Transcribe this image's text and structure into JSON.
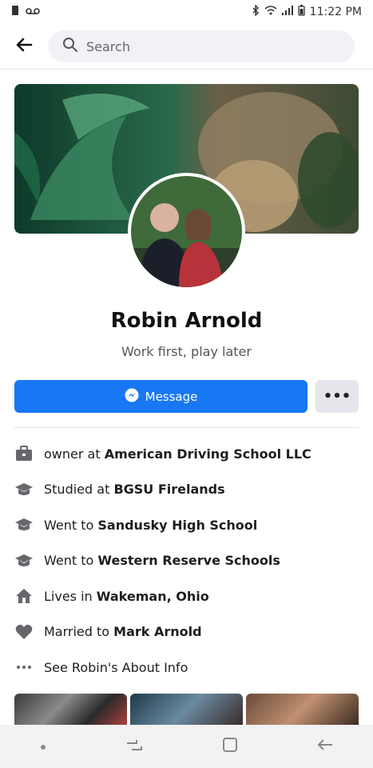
{
  "status": {
    "time": "11:22 PM"
  },
  "search": {
    "placeholder": "Search"
  },
  "profile": {
    "name": "Robin Arnold",
    "bio": "Work first, play later",
    "message_label": "Message",
    "more_label": "•••"
  },
  "info": [
    {
      "prefix": "owner at",
      "value": "American Driving School LLC",
      "icon": "briefcase-icon"
    },
    {
      "prefix": "Studied at",
      "value": "BGSU Firelands",
      "icon": "graduation-cap-icon"
    },
    {
      "prefix": "Went to",
      "value": "Sandusky High School",
      "icon": "graduation-cap-icon"
    },
    {
      "prefix": "Went to",
      "value": "Western Reserve Schools",
      "icon": "graduation-cap-icon"
    },
    {
      "prefix": "Lives in",
      "value": "Wakeman, Ohio",
      "icon": "house-icon"
    },
    {
      "prefix": "Married to",
      "value": "Mark Arnold",
      "icon": "heart-icon"
    },
    {
      "prefix": "See Robin's About Info",
      "value": "",
      "icon": "more-dots-icon"
    }
  ],
  "colors": {
    "primary": "#1877f2",
    "grey_bg": "#e4e6eb"
  }
}
